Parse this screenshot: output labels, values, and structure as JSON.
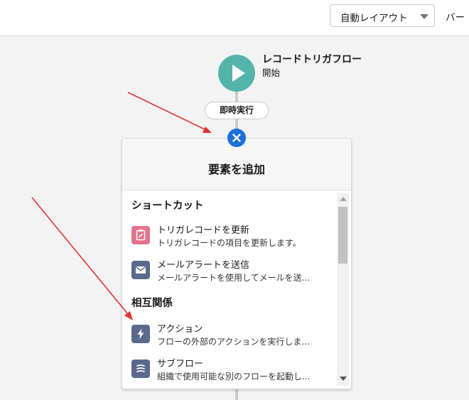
{
  "toolbar": {
    "layout_select_value": "自動レイアウト",
    "more_label": "バー"
  },
  "flow": {
    "start_title": "レコードトリガフロー",
    "start_subtitle": "開始",
    "run_label": "即時実行"
  },
  "panel": {
    "title": "要素を追加",
    "sections": [
      {
        "title": "ショートカット",
        "items": [
          {
            "icon": "clipboard-icon",
            "color": "#e3738c",
            "label": "トリガレコードを更新",
            "description": "トリガレコードの項目を更新します。"
          },
          {
            "icon": "envelope-icon",
            "color": "#5a6a8c",
            "label": "メールアラートを送信",
            "description": "メールアラートを使用してメールを送..."
          }
        ]
      },
      {
        "title": "相互関係",
        "items": [
          {
            "icon": "lightning-icon",
            "color": "#5a6a8c",
            "label": "アクション",
            "description": "フローの外部のアクションを実行しま..."
          },
          {
            "icon": "subflow-icon",
            "color": "#5a6a8c",
            "label": "サブフロー",
            "description": "組織で使用可能な別のフローを起動し..."
          }
        ]
      }
    ]
  },
  "colors": {
    "start_node": "#54b4ac",
    "close_button": "#1b6fd6",
    "annotation_arrow": "#e0332f"
  }
}
